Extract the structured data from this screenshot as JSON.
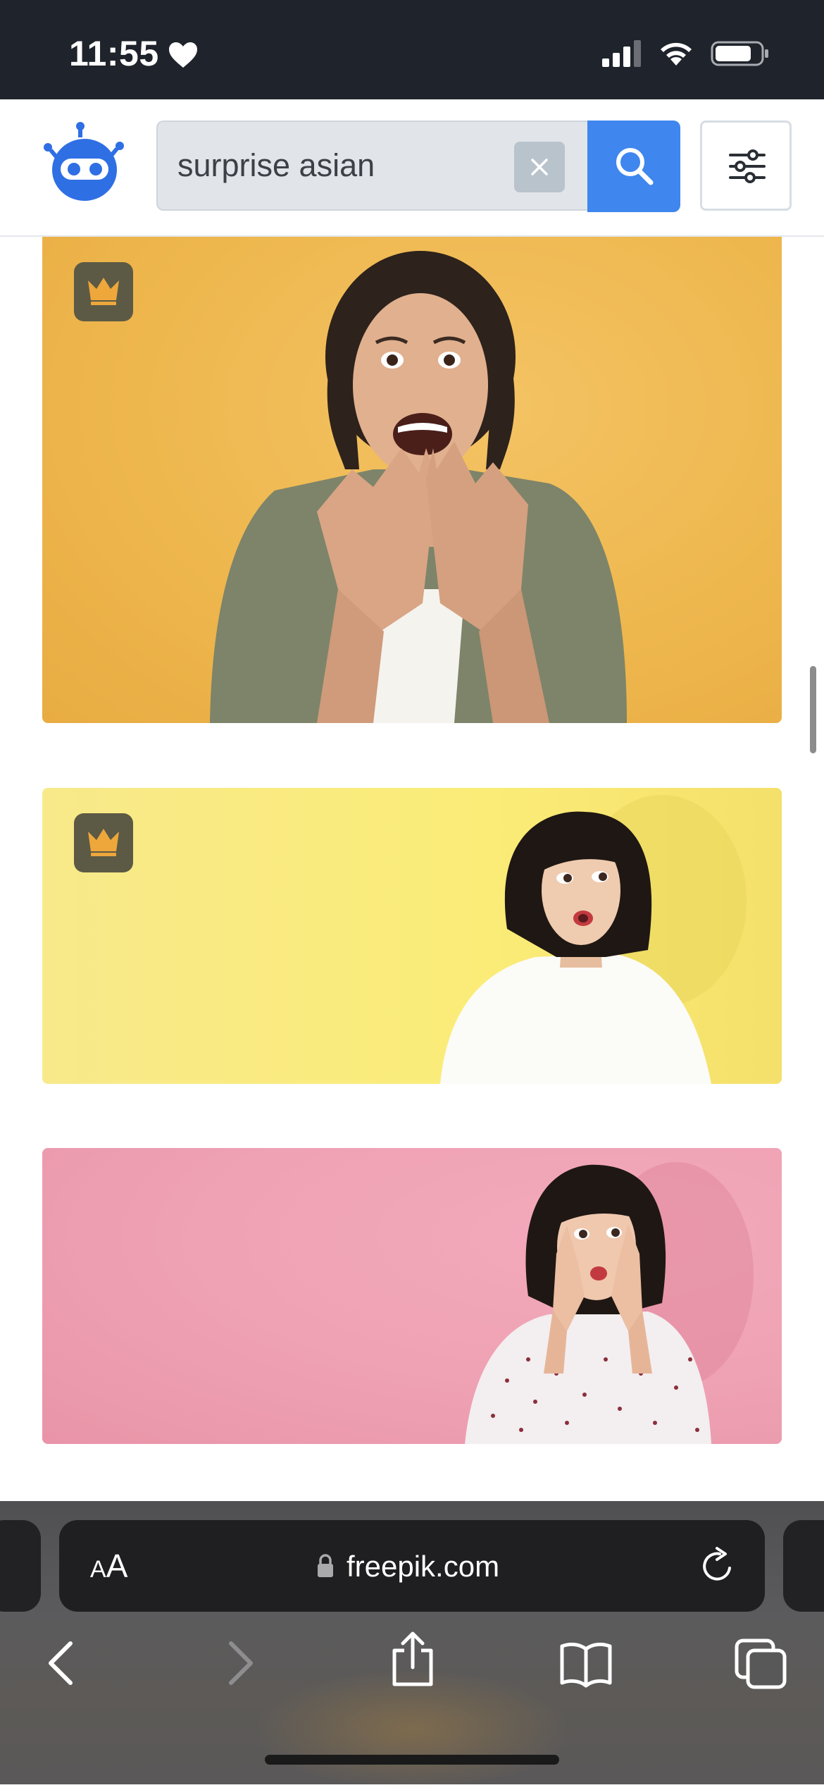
{
  "status_bar": {
    "time": "11:55",
    "heart_icon": "heart-icon",
    "signal_icon": "cellular-signal-icon",
    "wifi_icon": "wifi-icon",
    "battery_icon": "battery-icon"
  },
  "header": {
    "logo_icon": "freepik-robot-logo",
    "search": {
      "value": "surprise asian",
      "clear_icon": "close-icon",
      "submit_icon": "search-icon"
    },
    "filter_icon": "sliders-icon",
    "accent_color": "#3f86ee"
  },
  "results": [
    {
      "premium": true,
      "premium_icon": "crown-icon",
      "background": "#eeb74e"
    },
    {
      "premium": true,
      "premium_icon": "crown-icon",
      "background": "#fbec78"
    },
    {
      "premium": false,
      "background": "#eea1b3"
    }
  ],
  "browser": {
    "text_size_small": "A",
    "text_size_large": "A",
    "lock_icon": "lock-icon",
    "url": "freepik.com",
    "reload_icon": "reload-icon",
    "toolbar": {
      "back_icon": "chevron-left-icon",
      "forward_icon": "chevron-right-icon",
      "share_icon": "share-icon",
      "bookmarks_icon": "book-icon",
      "tabs_icon": "tabs-icon"
    }
  }
}
